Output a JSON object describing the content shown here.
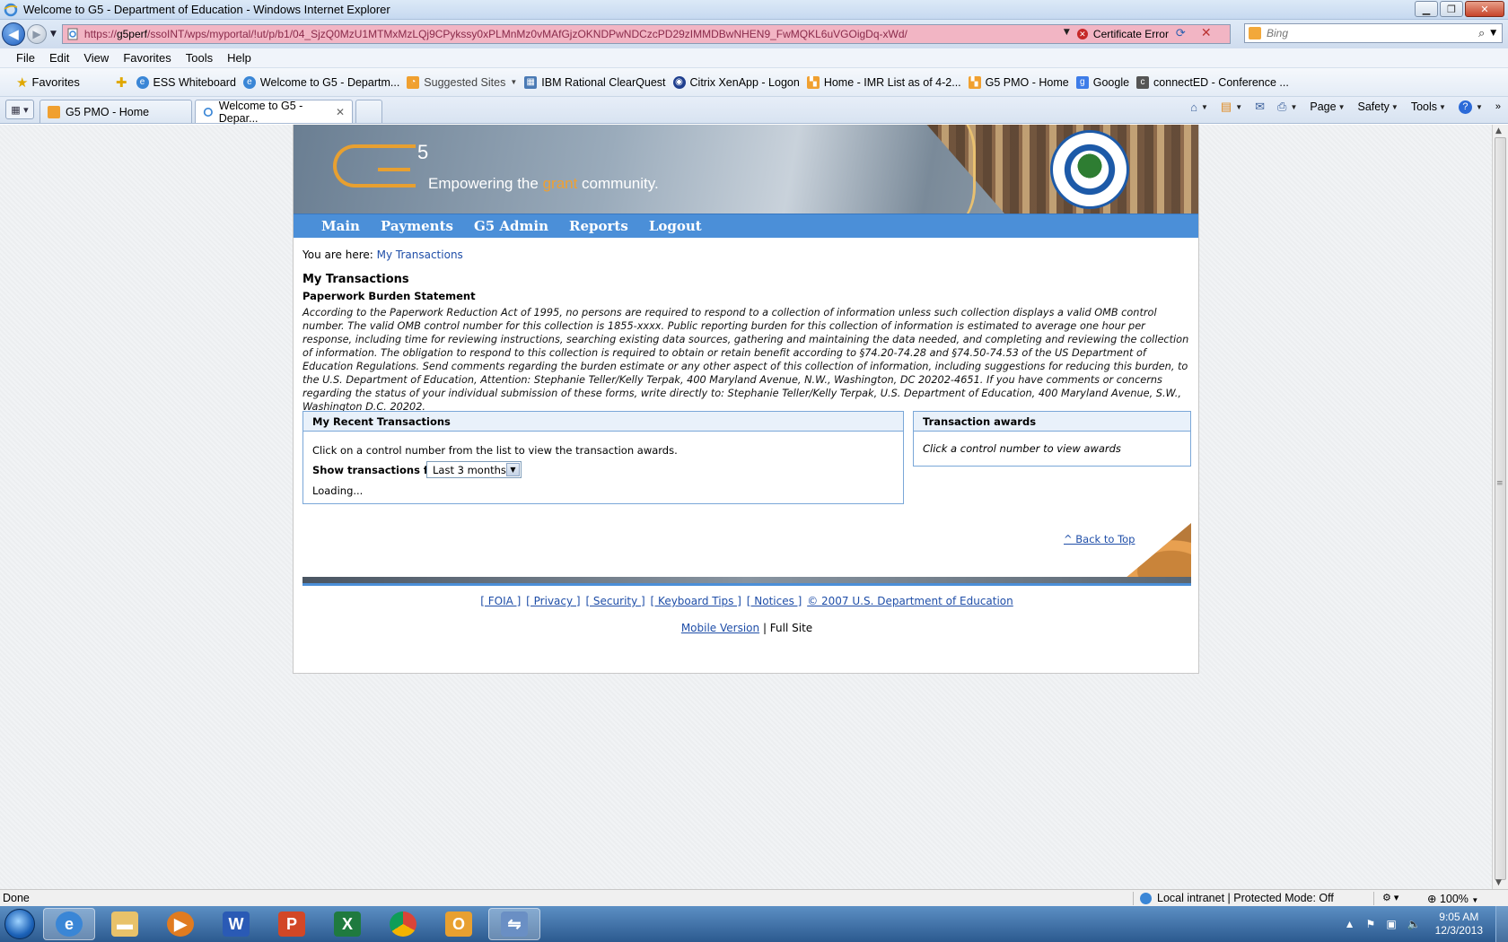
{
  "window": {
    "title": "Welcome to G5 - Department of Education - Windows Internet Explorer"
  },
  "address": {
    "url_prefix": "https://",
    "url_host": "g5perf",
    "url_path": "/ssoINT/wps/myportal/!ut/p/b1/04_SjzQ0MzU1MTMxMzLQj9CPykssy0xPLMnMz0vMAfGjzOKNDPwNDCzcPD29zIMMDBwNHEN9_FwMQKL6uVGOigDq-xWd/",
    "cert_error": "Certificate Error",
    "search_placeholder": "Bing"
  },
  "menu": [
    "File",
    "Edit",
    "View",
    "Favorites",
    "Tools",
    "Help"
  ],
  "favorites": {
    "label": "Favorites",
    "items": [
      {
        "label": "ESS Whiteboard",
        "icon": "ie-page-icon"
      },
      {
        "label": "Welcome to G5 - Departm...",
        "icon": "ie-page-icon"
      },
      {
        "label": "Suggested Sites",
        "icon": "suggested-sites-icon"
      },
      {
        "label": "IBM Rational ClearQuest",
        "icon": "grid-icon"
      },
      {
        "label": "Citrix XenApp - Logon",
        "icon": "citrix-icon"
      },
      {
        "label": "Home - IMR List as of 4-2...",
        "icon": "sharepoint-icon"
      },
      {
        "label": "G5 PMO - Home",
        "icon": "sharepoint-icon"
      },
      {
        "label": "Google",
        "icon": "google-icon"
      },
      {
        "label": "connectED - Conference ...",
        "icon": "ce-icon"
      }
    ]
  },
  "tabs": [
    {
      "label": "G5 PMO - Home",
      "active": false
    },
    {
      "label": "Welcome to G5 - Depar...",
      "active": true
    }
  ],
  "command_bar": {
    "page": "Page",
    "safety": "Safety",
    "tools": "Tools"
  },
  "g5": {
    "brand_sup": "5",
    "tagline_pre": "Empowering the ",
    "tagline_grant": "grant",
    "tagline_post": " community.",
    "nav": [
      "Main",
      "Payments",
      "G5 Admin",
      "Reports",
      "Logout"
    ],
    "crumb_prefix": "You are here: ",
    "crumb_link": "My Transactions",
    "page_title": "My Transactions",
    "subtitle": "Paperwork Burden Statement",
    "burden_text": "According to the Paperwork Reduction Act of 1995, no persons are required to respond to a collection of information unless such collection displays a valid OMB control number. The valid OMB control number for this collection is 1855-xxxx. Public reporting burden for this collection of information is estimated to average one hour per response, including time for reviewing instructions, searching existing data sources, gathering and maintaining the data needed, and completing and reviewing the collection of information. The obligation to respond to this collection is required to obtain or retain benefit according to §74.20-74.28 and §74.50-74.53 of the US Department of Education Regulations. Send comments regarding the burden estimate or any other aspect of this collection of information, including suggestions for reducing this burden, to the U.S. Department of Education, Attention: Stephanie Teller/Kelly Terpak, 400 Maryland Avenue, N.W., Washington, DC 20202-4651. If you have comments or concerns regarding the status of your individual submission of these forms, write directly to: Stephanie Teller/Kelly Terpak, U.S. Department of Education, 400 Maryland Avenue, S.W., Washington D.C. 20202.",
    "recent": {
      "title": "My Recent Transactions",
      "instructions": "Click on a control number from the list to view the transaction awards.",
      "show_label": "Show transactions for:",
      "show_value": "Last 3 months",
      "loading": "Loading..."
    },
    "awards": {
      "title": "Transaction awards",
      "hint": "Click a control number to view awards"
    },
    "back_to_top": "^ Back to Top",
    "footer_links": [
      "[ FOIA ]",
      "[ Privacy ]",
      "[ Security ]",
      "[ Keyboard Tips ]",
      "[ Notices ]",
      "© 2007 U.S. Department of Education"
    ],
    "mobile_link": "Mobile Version",
    "full_site": " | Full Site"
  },
  "status": {
    "left": "Done",
    "zone": "Local intranet | Protected Mode: Off",
    "zoom": "100%"
  },
  "taskbar": {
    "time": "9:05 AM",
    "date": "12/3/2013"
  }
}
